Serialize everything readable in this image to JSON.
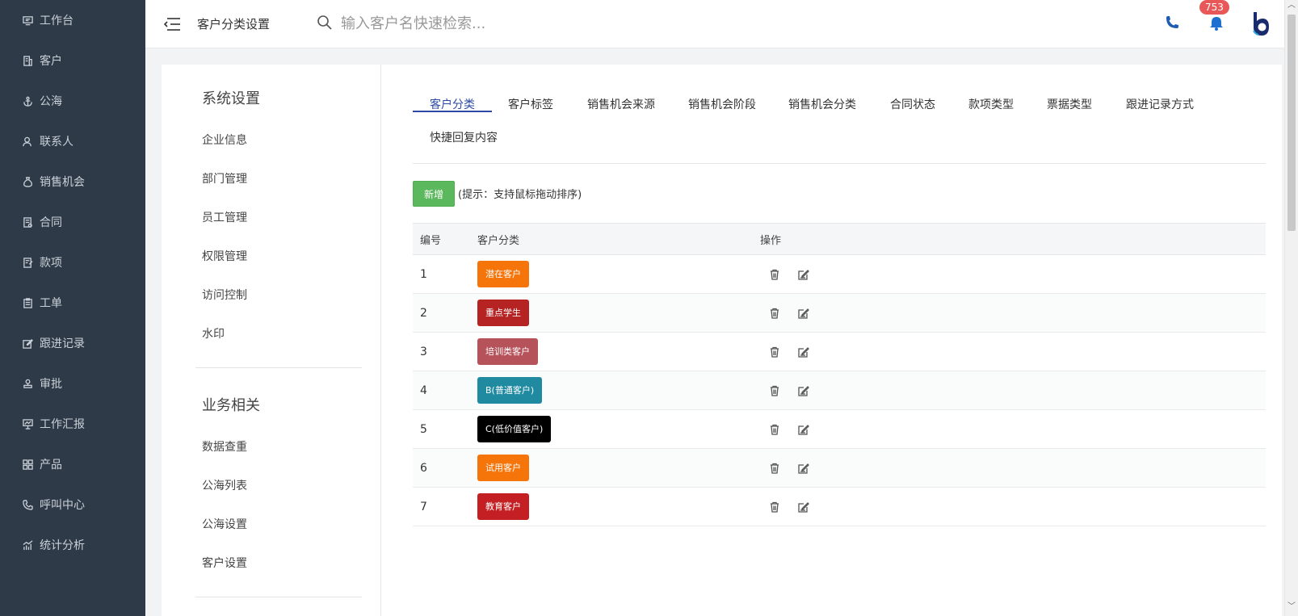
{
  "sidebar": {
    "items": [
      {
        "label": "工作台",
        "icon": "monitor-icon"
      },
      {
        "label": "客户",
        "icon": "building-icon"
      },
      {
        "label": "公海",
        "icon": "anchor-icon"
      },
      {
        "label": "联系人",
        "icon": "user-icon"
      },
      {
        "label": "销售机会",
        "icon": "money-bag-icon"
      },
      {
        "label": "合同",
        "icon": "contract-icon"
      },
      {
        "label": "款项",
        "icon": "payment-icon"
      },
      {
        "label": "工单",
        "icon": "clipboard-icon"
      },
      {
        "label": "跟进记录",
        "icon": "edit-icon"
      },
      {
        "label": "审批",
        "icon": "stamp-icon"
      },
      {
        "label": "工作汇报",
        "icon": "presentation-icon"
      },
      {
        "label": "产品",
        "icon": "grid-icon"
      },
      {
        "label": "呼叫中心",
        "icon": "phone-icon"
      },
      {
        "label": "统计分析",
        "icon": "chart-icon"
      }
    ]
  },
  "header": {
    "title": "客户分类设置",
    "search_placeholder": "输入客户名快速检索...",
    "notification_count": "753"
  },
  "settings_menu": {
    "system_title": "系统设置",
    "system_items": [
      "企业信息",
      "部门管理",
      "员工管理",
      "权限管理",
      "访问控制",
      "水印"
    ],
    "business_title": "业务相关",
    "business_items": [
      "数据查重",
      "公海列表",
      "公海设置",
      "客户设置"
    ]
  },
  "tabs": [
    "客户分类",
    "客户标签",
    "销售机会来源",
    "销售机会阶段",
    "销售机会分类",
    "合同状态",
    "款项类型",
    "票据类型",
    "跟进记录方式",
    "快捷回复内容"
  ],
  "active_tab": "客户分类",
  "toolbar": {
    "add_label": "新增",
    "hint": "(提示：支持鼠标拖动排序)"
  },
  "table": {
    "headers": [
      "编号",
      "客户分类",
      "操作"
    ],
    "rows": [
      {
        "id": "1",
        "name": "潜在客户",
        "color": "#f5750b"
      },
      {
        "id": "2",
        "name": "重点学生",
        "color": "#b52323"
      },
      {
        "id": "3",
        "name": "培训类客户",
        "color": "#b5525a"
      },
      {
        "id": "4",
        "name": "B(普通客户)",
        "color": "#1f8aa0"
      },
      {
        "id": "5",
        "name": "C(低价值客户)",
        "color": "#000000"
      },
      {
        "id": "6",
        "name": "试用客户",
        "color": "#f5750b"
      },
      {
        "id": "7",
        "name": "教育客户",
        "color": "#c41f22"
      }
    ]
  },
  "colors": {
    "sidebar_bg": "#2f3a48",
    "accent": "#2c4aa3",
    "add_button": "#5cb85c",
    "badge": "#e85858"
  }
}
